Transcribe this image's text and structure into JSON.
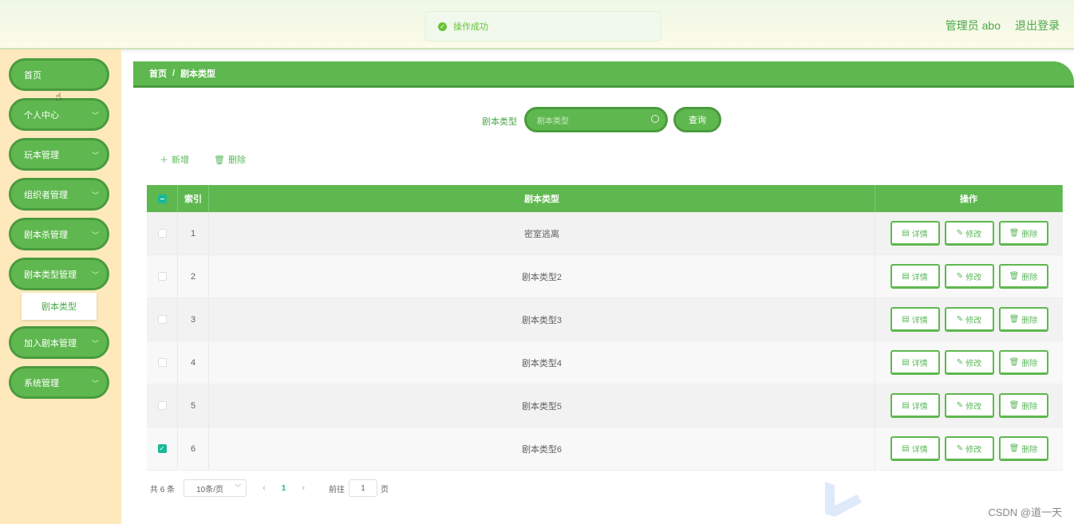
{
  "header": {
    "user_label": "管理员 abo",
    "logout": "退出登录"
  },
  "toast": {
    "message": "操作成功",
    "color": "#67c23a"
  },
  "sidebar": {
    "items": [
      {
        "label": "首页",
        "top": 0,
        "chevron": false
      },
      {
        "label": "个人中心",
        "chevron": true
      },
      {
        "label": "玩本管理",
        "chevron": true
      },
      {
        "label": "组织者管理",
        "chevron": true
      },
      {
        "label": "剧本杀管理",
        "chevron": true
      },
      {
        "label": "剧本类型管理",
        "chevron": true
      },
      {
        "label": "加入剧本管理",
        "chevron": true
      },
      {
        "label": "系统管理",
        "chevron": true
      }
    ],
    "submenu": {
      "label": "剧本类型"
    }
  },
  "breadcrumb": {
    "home": "首页",
    "sep": "/",
    "current": "剧本类型"
  },
  "search": {
    "label": "剧本类型",
    "placeholder": "剧本类型",
    "button": "查询"
  },
  "actions": {
    "add": "新增",
    "delete": "删除"
  },
  "table": {
    "headers": {
      "index": "索引",
      "type": "剧本类型",
      "ops": "操作"
    },
    "rows": [
      {
        "index": "1",
        "type": "密室逃离",
        "checked": false
      },
      {
        "index": "2",
        "type": "剧本类型2",
        "checked": false
      },
      {
        "index": "3",
        "type": "剧本类型3",
        "checked": false
      },
      {
        "index": "4",
        "type": "剧本类型4",
        "checked": false
      },
      {
        "index": "5",
        "type": "剧本类型5",
        "checked": false
      },
      {
        "index": "6",
        "type": "剧本类型6",
        "checked": true
      }
    ],
    "op_labels": {
      "detail": "详情",
      "edit": "修改",
      "delete": "删除"
    }
  },
  "pagination": {
    "total": "共 6 条",
    "page_size": "10条/页",
    "current": "1",
    "goto_prefix": "前往",
    "goto_value": "1",
    "goto_suffix": "页"
  },
  "watermark": "CSDN @道一天",
  "colors": {
    "primary": "#5fb84f",
    "primary_dark": "#4a9b3e",
    "sidebar_bg": "#fde9bc",
    "checkbox": "#18b99a"
  }
}
